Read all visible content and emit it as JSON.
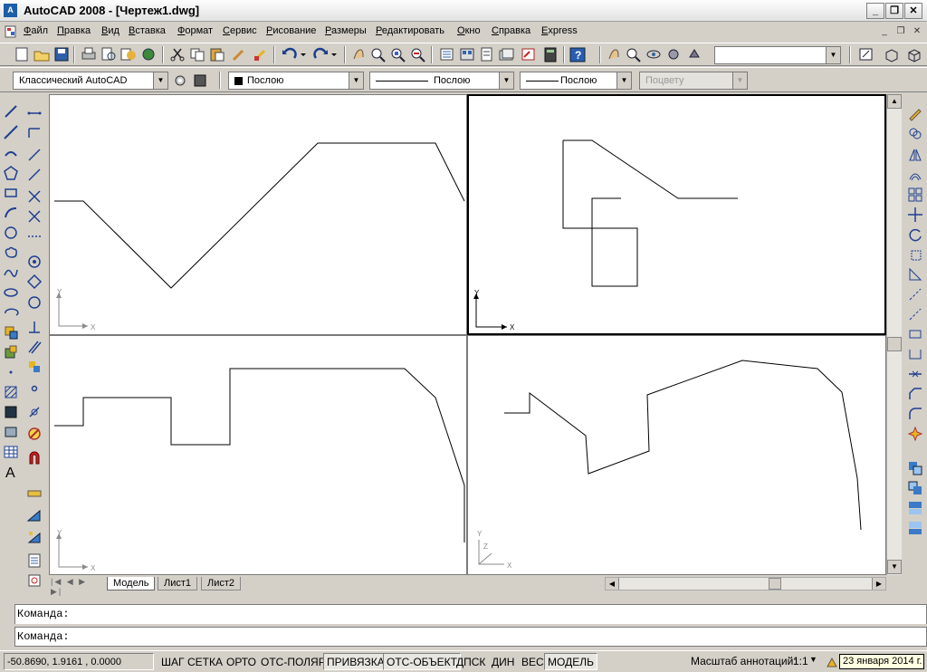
{
  "window": {
    "app_icon_text": "A",
    "title": "AutoCAD 2008 - [Чертеж1.dwg]",
    "minimize": "_",
    "restore": "❐",
    "close": "✕",
    "mdi_min": "_",
    "mdi_restore": "❐",
    "mdi_close": "✕"
  },
  "menu": [
    "Файл",
    "Правка",
    "Вид",
    "Вставка",
    "Формат",
    "Сервис",
    "Рисование",
    "Размеры",
    "Редактировать",
    "Окно",
    "Справка",
    "Express"
  ],
  "toolbar": {
    "workspace": "Классический AutoCAD",
    "layer_color": "Послою",
    "linetype": "Послою",
    "lineweight": "Послою",
    "plotstyle": "Поцвету"
  },
  "viewports": {
    "axis_x": "X",
    "axis_y": "Y",
    "axis_z": "Z"
  },
  "tabs": [
    "Модель",
    "Лист1",
    "Лист2"
  ],
  "command": {
    "line1": "Команда:",
    "line2": "Команда:"
  },
  "status": {
    "coords": "-50.8690, 1.9161 , 0.0000",
    "toggles": [
      "ШАГ",
      "СЕТКА",
      "ОРТО",
      "ОТС-ПОЛЯР",
      "ПРИВЯЗКА",
      "ОТС-ОБЪЕКТ",
      "ДПСК",
      "ДИН",
      "ВЕС",
      "МОДЕЛЬ"
    ],
    "annotation_scale_label": "Масштаб аннотаций:",
    "annotation_scale": "1:1",
    "date": "23 января 2014 г."
  },
  "colors": {
    "accent": "#1c5ea8",
    "canvas": "#ffffff",
    "chrome": "#d4d0c8"
  }
}
